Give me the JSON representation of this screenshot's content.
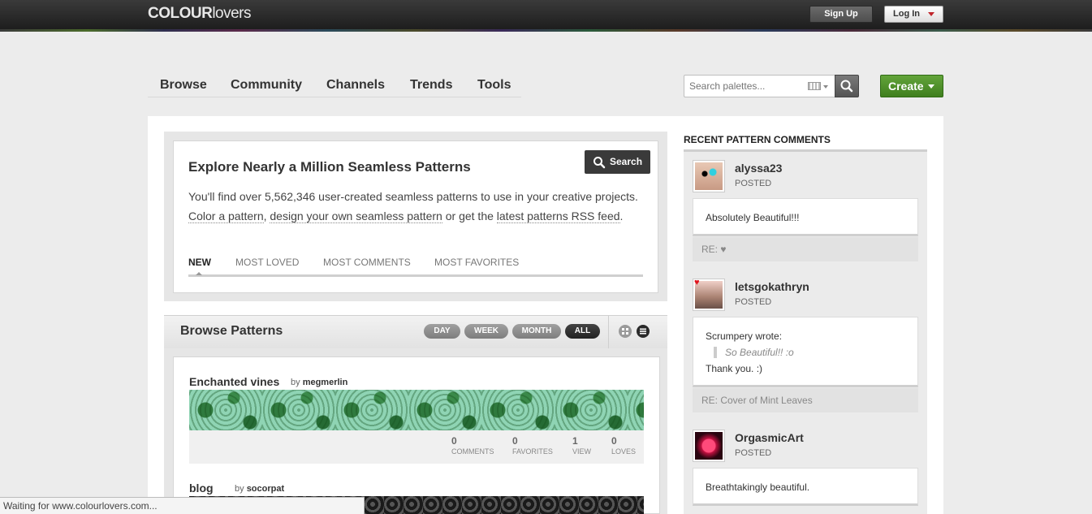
{
  "header": {
    "logo_bold": "COLOUR",
    "logo_light": "lovers",
    "signup_label": "Sign Up",
    "login_label": "Log In"
  },
  "nav": {
    "items": [
      "Browse",
      "Community",
      "Channels",
      "Trends",
      "Tools"
    ]
  },
  "search": {
    "placeholder": "Search palettes..."
  },
  "create_label": "Create",
  "explore": {
    "title": "Explore Nearly a Million Seamless Patterns",
    "search_label": "Search",
    "desc_1": "You'll find over 5,562,346 user-created seamless patterns to use in your creative projects. ",
    "link_color": "Color a pattern",
    "desc_2": ", ",
    "link_design": "design your own seamless pattern",
    "desc_3": " or get the ",
    "link_rss": "latest patterns RSS feed",
    "desc_4": ".",
    "tabs": [
      "NEW",
      "MOST LOVED",
      "MOST COMMENTS",
      "MOST FAVORITES"
    ]
  },
  "browse": {
    "title": "Browse Patterns",
    "ranges": [
      "DAY",
      "WEEK",
      "MONTH",
      "ALL"
    ]
  },
  "patterns": [
    {
      "title": "Enchanted vines",
      "by_prefix": "by",
      "author": "megmerlin",
      "stats": [
        {
          "value": "0",
          "label": "COMMENTS"
        },
        {
          "value": "0",
          "label": "FAVORITES"
        },
        {
          "value": "1",
          "label": "VIEW"
        },
        {
          "value": "0",
          "label": "LOVES"
        }
      ]
    },
    {
      "title": "blog",
      "by_prefix": "by",
      "author": "socorpat"
    }
  ],
  "sidebar": {
    "title": "RECENT PATTERN COMMENTS",
    "comments": [
      {
        "user": "alyssa23",
        "status": "POSTED",
        "text": "Absolutely Beautiful!!!",
        "re": "RE: ♥"
      },
      {
        "user": "letsgokathryn",
        "status": "POSTED",
        "quote_intro": "Scrumpery wrote:",
        "quote": "So Beautiful!! :o",
        "text": "Thank you. :)",
        "re": "RE: Cover of Mint Leaves"
      },
      {
        "user": "OrgasmicArt",
        "status": "POSTED",
        "text": "Breathtakingly beautiful."
      }
    ]
  },
  "status_bar": "Waiting for www.colourlovers.com...",
  "colors": {
    "create_green": "#4f9229",
    "login_caret": "#c0262c",
    "dark_pill": "#333333"
  }
}
